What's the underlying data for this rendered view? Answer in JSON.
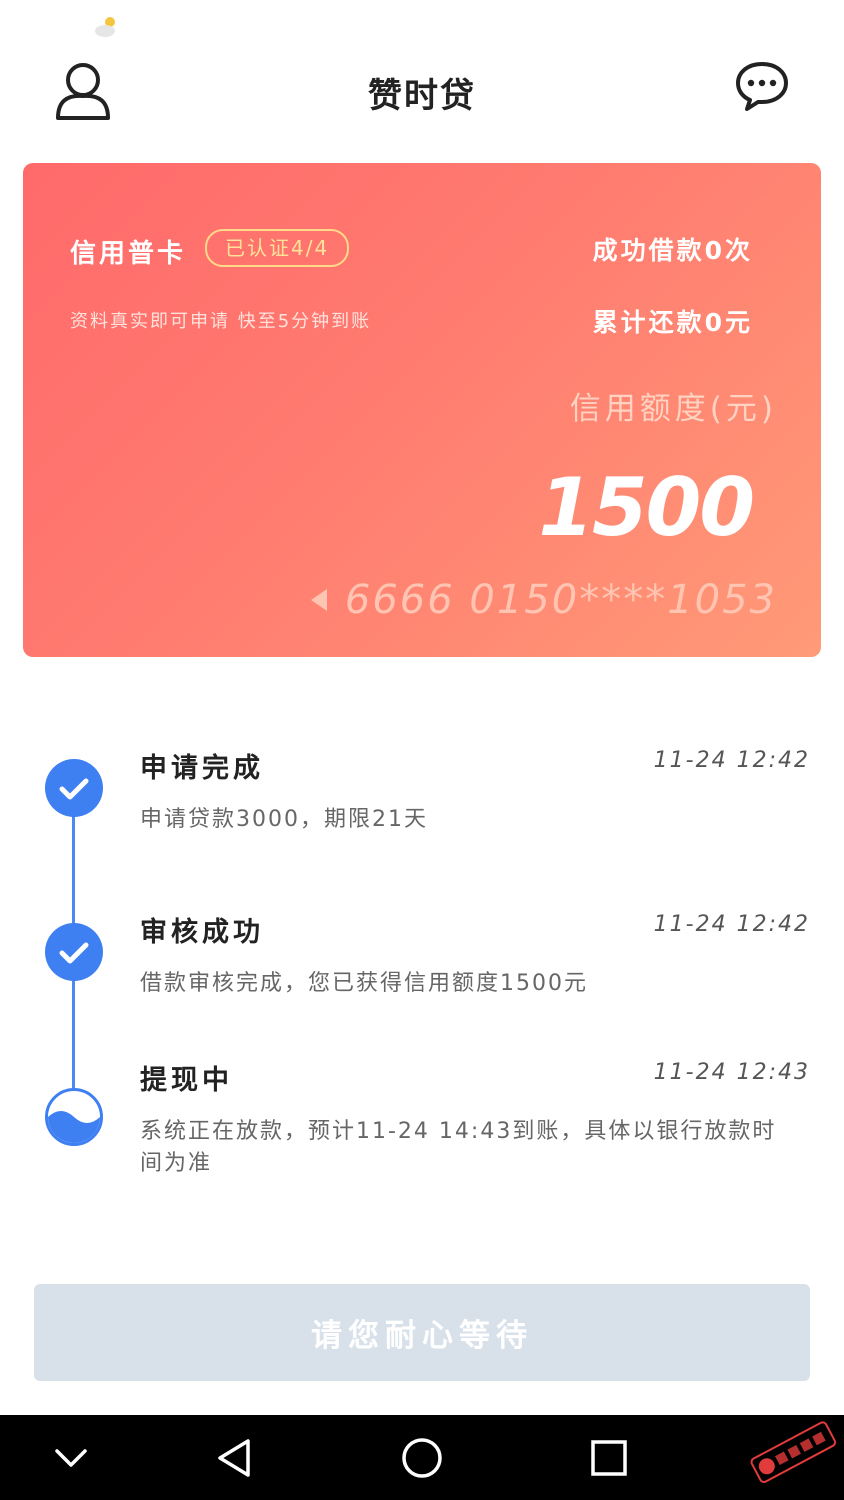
{
  "colors": {
    "accent_blue": "#3e7ff2",
    "card_gradient_start": "#ff6a6a",
    "card_gradient_end": "#ff9a77",
    "badge_gold": "#ffd98a",
    "button_disabled": "#d8e1ea"
  },
  "statusbar": {
    "icon": "weather-partly-cloudy-icon"
  },
  "header": {
    "title": "赞时贷",
    "left_icon": "user-profile-icon",
    "right_icon": "message-chat-icon"
  },
  "card": {
    "type": "信用普卡",
    "badge": "已认证4/4",
    "note": "资料真实即可申请 快至5分钟到账",
    "success_loans": "成功借款0次",
    "total_repaid": "累计还款0元",
    "limit_label": "信用额度(元)",
    "limit_value": "1500",
    "card_number": "6666 0150****1053"
  },
  "timeline": {
    "steps": [
      {
        "title": "申请完成",
        "time": "11-24 12:42",
        "desc": "申请贷款3000，期限21天",
        "status": "done"
      },
      {
        "title": "审核成功",
        "time": "11-24 12:42",
        "desc": "借款审核完成，您已获得信用额度1500元",
        "status": "done"
      },
      {
        "title": "提现中",
        "time": "11-24 12:43",
        "desc": "系统正在放款，预计11-24 14:43到账，具体以银行放款时间为准",
        "status": "in_progress"
      }
    ]
  },
  "action_button": {
    "label": "请您耐心等待",
    "enabled": false
  },
  "navbar": {
    "items": [
      "collapse-chevron-icon",
      "back-triangle-icon",
      "home-circle-icon",
      "recents-square-icon"
    ]
  },
  "watermark": {
    "text": "卡农社区"
  }
}
